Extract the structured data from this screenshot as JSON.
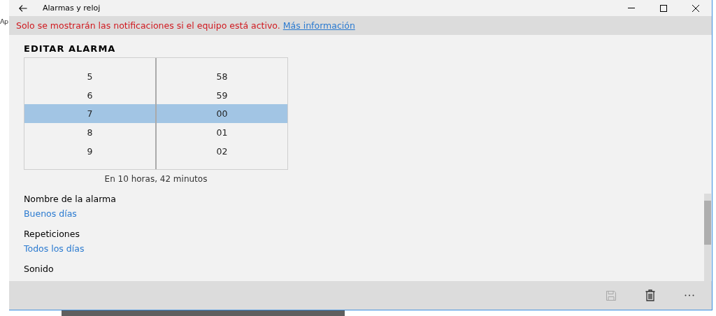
{
  "background_app": {
    "label": "Ap"
  },
  "window": {
    "title": "Alarmas y reloj"
  },
  "banner": {
    "message": "Solo se mostrarán las notificaciones si el equipo está activo.",
    "link": "Más información"
  },
  "heading": "EDITAR ALARMA",
  "time_picker": {
    "hours": [
      {
        "value": "5",
        "selected": false
      },
      {
        "value": "6",
        "selected": false
      },
      {
        "value": "7",
        "selected": true
      },
      {
        "value": "8",
        "selected": false
      },
      {
        "value": "9",
        "selected": false
      }
    ],
    "minutes": [
      {
        "value": "58",
        "selected": false
      },
      {
        "value": "59",
        "selected": false
      },
      {
        "value": "00",
        "selected": true
      },
      {
        "value": "01",
        "selected": false
      },
      {
        "value": "02",
        "selected": false
      }
    ]
  },
  "countdown": "En 10 horas, 42 minutos",
  "fields": [
    {
      "label": "Nombre de la alarma",
      "value": "Buenos días"
    },
    {
      "label": "Repeticiones",
      "value": "Todos los días"
    },
    {
      "label": "Sonido"
    }
  ],
  "toolbar": [
    {
      "kind": "save",
      "disabled": true
    },
    {
      "kind": "delete",
      "disabled": false
    },
    {
      "kind": "more",
      "disabled": false
    }
  ]
}
